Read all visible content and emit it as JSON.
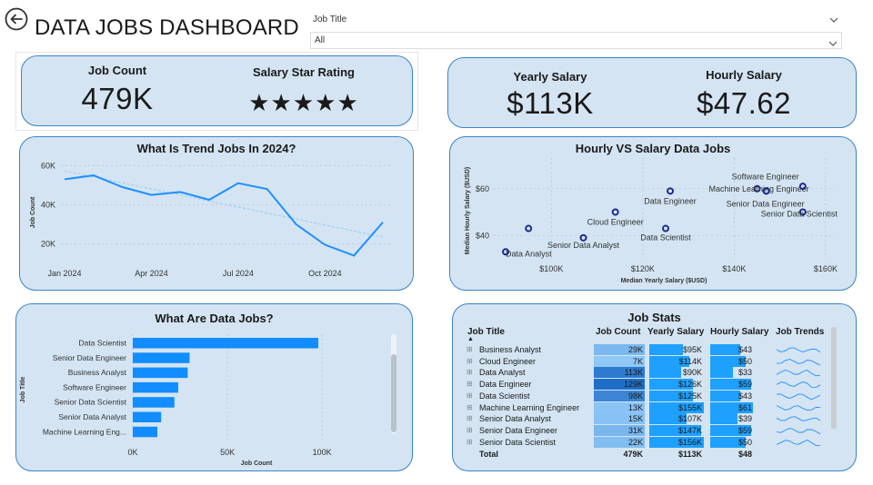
{
  "header": {
    "title": "DATA JOBS DASHBOARD",
    "filter_label": "Job Title",
    "filter_value": "All"
  },
  "kpi": {
    "job_count_label": "Job Count",
    "job_count_value": "479K",
    "star_label": "Salary Star Rating",
    "stars": "★★★★★",
    "star_rating": 5,
    "yearly_label": "Yearly Salary",
    "yearly_value": "$113K",
    "hourly_label": "Hourly Salary",
    "hourly_value": "$47.62"
  },
  "charts": {
    "trend_title": "What Is Trend Jobs In 2024?",
    "scatter_title": "Hourly VS Salary Data Jobs",
    "bar_title": "What Are Data Jobs?",
    "table_title": "Job Stats"
  },
  "chart_data": [
    {
      "type": "line",
      "title": "What Is Trend Jobs In 2024?",
      "ylabel": "Job Count",
      "x_ticks": [
        "Jan 2024",
        "Apr 2024",
        "Jul 2024",
        "Oct 2024"
      ],
      "y_ticks": [
        "20K",
        "40K",
        "60K"
      ],
      "ylim": [
        10000,
        62000
      ],
      "x": [
        "Jan 2024",
        "Feb 2024",
        "Mar 2024",
        "Apr 2024",
        "May 2024",
        "Jun 2024",
        "Jul 2024",
        "Aug 2024",
        "Sep 2024",
        "Oct 2024",
        "Nov 2024",
        "Dec 2024"
      ],
      "values": [
        53000,
        55000,
        49000,
        45000,
        46500,
        42500,
        51000,
        48000,
        30000,
        19500,
        14000,
        31000
      ],
      "trendline": true,
      "colors": {
        "line": "#1e90ff",
        "trend": "#9fd0f5"
      }
    },
    {
      "type": "scatter",
      "title": "Hourly VS Salary Data Jobs",
      "xlabel": "Median Yearly Salary ($USD)",
      "ylabel": "Median Hourly Salary ($USD)",
      "x_ticks": [
        "$100K",
        "$120K",
        "$140K",
        "$160K"
      ],
      "y_ticks": [
        "$40",
        "$60"
      ],
      "xlim": [
        88000,
        162000
      ],
      "ylim": [
        30,
        70
      ],
      "points": [
        {
          "label": "Data Analyst",
          "x": 90000,
          "y": 33
        },
        {
          "label": "Business Analyst",
          "x": 95000,
          "y": 43
        },
        {
          "label": "Senior Data Analyst",
          "x": 107000,
          "y": 39
        },
        {
          "label": "Cloud Engineer",
          "x": 114000,
          "y": 50
        },
        {
          "label": "Data Scientist",
          "x": 125000,
          "y": 43
        },
        {
          "label": "Data Engineer",
          "x": 126000,
          "y": 59
        },
        {
          "label": "Software Engineer",
          "x": 147000,
          "y": 59
        },
        {
          "label": "Machine Learning Engineer",
          "x": 145000,
          "y": 60
        },
        {
          "label": "Senior Data Engineer",
          "x": 147000,
          "y": 59
        },
        {
          "label": "Senior Data Scientist",
          "x": 155000,
          "y": 50
        },
        {
          "label": "",
          "x": 155000,
          "y": 61
        }
      ],
      "colors": {
        "marker": "#1a2a8c"
      }
    },
    {
      "type": "bar",
      "orientation": "horizontal",
      "title": "What Are Data Jobs?",
      "xlabel": "Job Count",
      "ylabel": "Job Title",
      "categories": [
        "Data Scientist",
        "Senior Data Engineer",
        "Business Analyst",
        "Software Engineer",
        "Senior Data Scientist",
        "Senior Data Analyst",
        "Machine Learning Eng..."
      ],
      "values": [
        98000,
        30000,
        29000,
        24000,
        22000,
        15000,
        13000
      ],
      "x_ticks": [
        "0K",
        "50K",
        "100K"
      ],
      "xlim": [
        0,
        110000
      ],
      "colors": {
        "bar": "#118dff"
      }
    },
    {
      "type": "table",
      "title": "Job Stats",
      "columns": [
        "Job Title",
        "Job Count",
        "Yearly Salary",
        "Hourly Salary",
        "Job Trends"
      ],
      "rows": [
        [
          "Business Analyst",
          "29K",
          "$95K",
          "$43"
        ],
        [
          "Cloud Engineer",
          "7K",
          "$114K",
          "$50"
        ],
        [
          "Data Analyst",
          "113K",
          "$90K",
          "$33"
        ],
        [
          "Data Engineer",
          "129K",
          "$126K",
          "$59"
        ],
        [
          "Data Scientist",
          "98K",
          "$125K",
          "$43"
        ],
        [
          "Machine Learning Engineer",
          "13K",
          "$155K",
          "$61"
        ],
        [
          "Senior Data Analyst",
          "15K",
          "$107K",
          "$39"
        ],
        [
          "Senior Data Engineer",
          "31K",
          "$147K",
          "$59"
        ],
        [
          "Senior Data Scientist",
          "22K",
          "$156K",
          "$50"
        ]
      ],
      "total": [
        "Total",
        "479K",
        "$113K",
        "$48"
      ],
      "job_count_values": [
        29000,
        7000,
        113000,
        129000,
        98000,
        13000,
        15000,
        31000,
        22000
      ],
      "yearly_values": [
        95000,
        114000,
        90000,
        126000,
        125000,
        155000,
        107000,
        147000,
        156000
      ],
      "hourly_values": [
        43,
        50,
        33,
        59,
        43,
        61,
        39,
        59,
        50
      ]
    }
  ]
}
